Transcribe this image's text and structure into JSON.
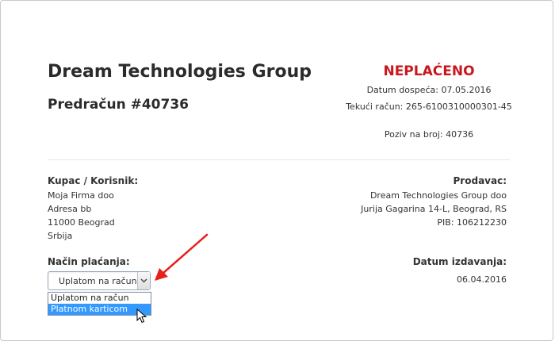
{
  "header": {
    "company": "Dream Technologies Group",
    "invoice_title": "Predračun #40736",
    "status": "NEPLAĆENO",
    "due_date": "Datum dospeća: 07.05.2016",
    "account": "Tekući račun: 265-6100310000301-45",
    "reference": "Poziv na broj: 40736"
  },
  "buyer": {
    "heading": "Kupac / Korisnik:",
    "lines": [
      "Moja Firma doo",
      "Adresa bb",
      "11000 Beograd",
      "Srbija"
    ]
  },
  "seller": {
    "heading": "Prodavac:",
    "lines": [
      "Dream Technologies Group doo",
      "Jurija Gagarina 14-L, Beograd, RS",
      "PIB: 106212230"
    ]
  },
  "payment": {
    "heading": "Način plaćanja:",
    "selected": "Uplatom na račun",
    "options": [
      "Uplatom na račun",
      "Platnom karticom"
    ],
    "highlighted_option": "Platnom karticom"
  },
  "issue": {
    "heading": "Datum izdavanja:",
    "date": "06.04.2016"
  },
  "colors": {
    "status_red": "#c8181f",
    "highlight_blue": "#3399ff",
    "annotation_arrow": "#e8201c"
  },
  "icons": {
    "dropdown": "chevron-down-icon",
    "annotation": "red-arrow-icon",
    "cursor": "mouse-pointer-icon"
  }
}
